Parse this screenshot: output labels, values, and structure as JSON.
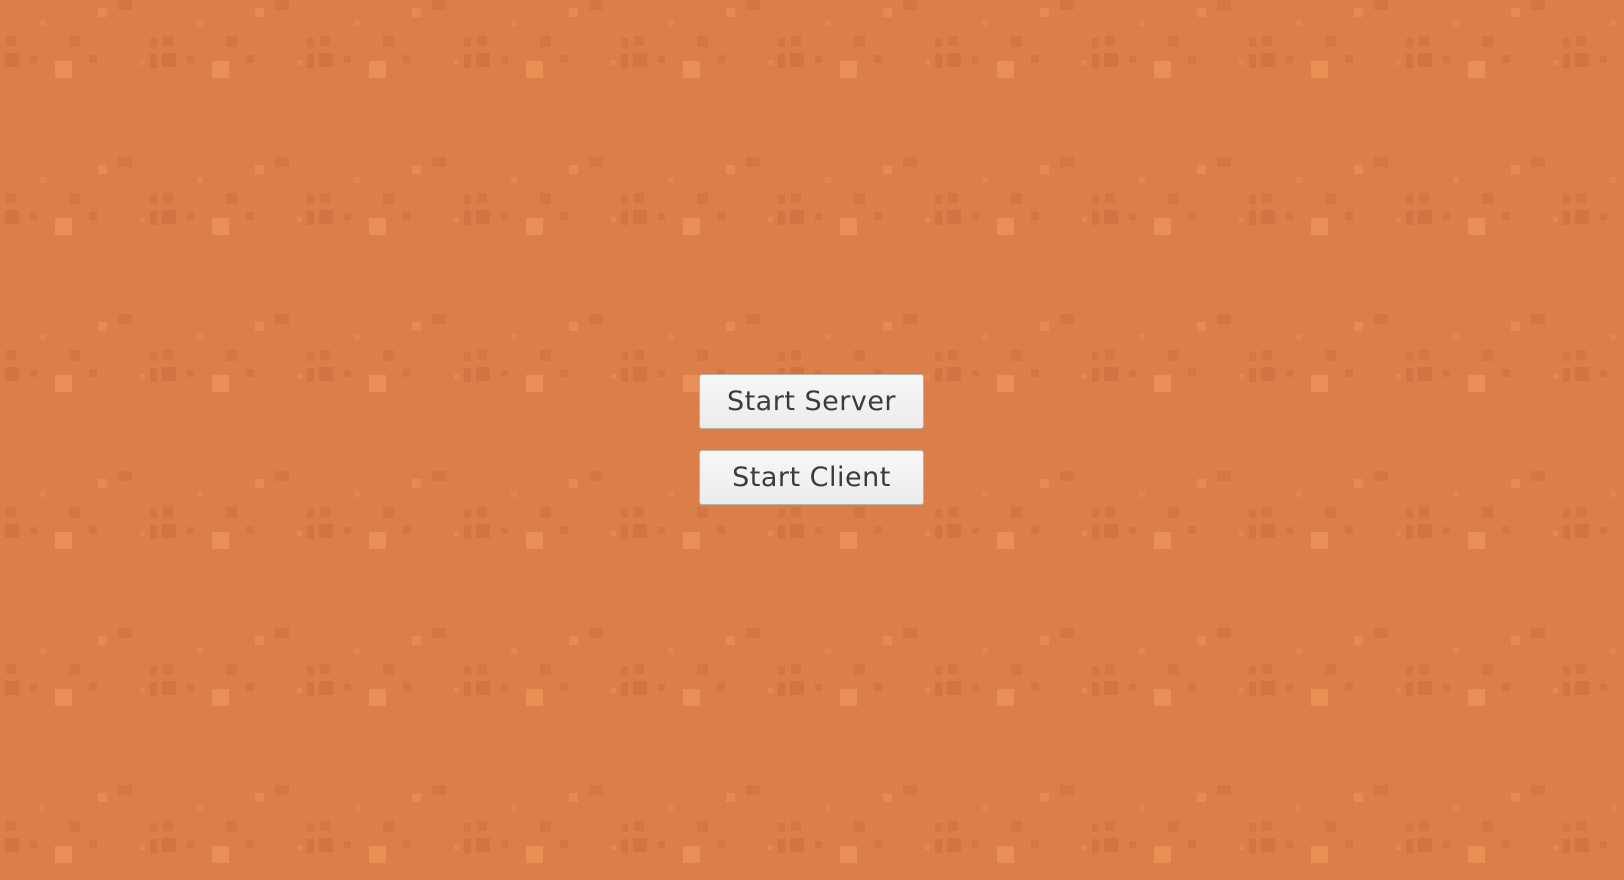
{
  "background": {
    "color": "#db7e4a",
    "pattern_dark": "#c66c3c",
    "pattern_light": "#eb9258"
  },
  "menu": {
    "start_server_label": "Start Server",
    "start_client_label": "Start Client"
  }
}
